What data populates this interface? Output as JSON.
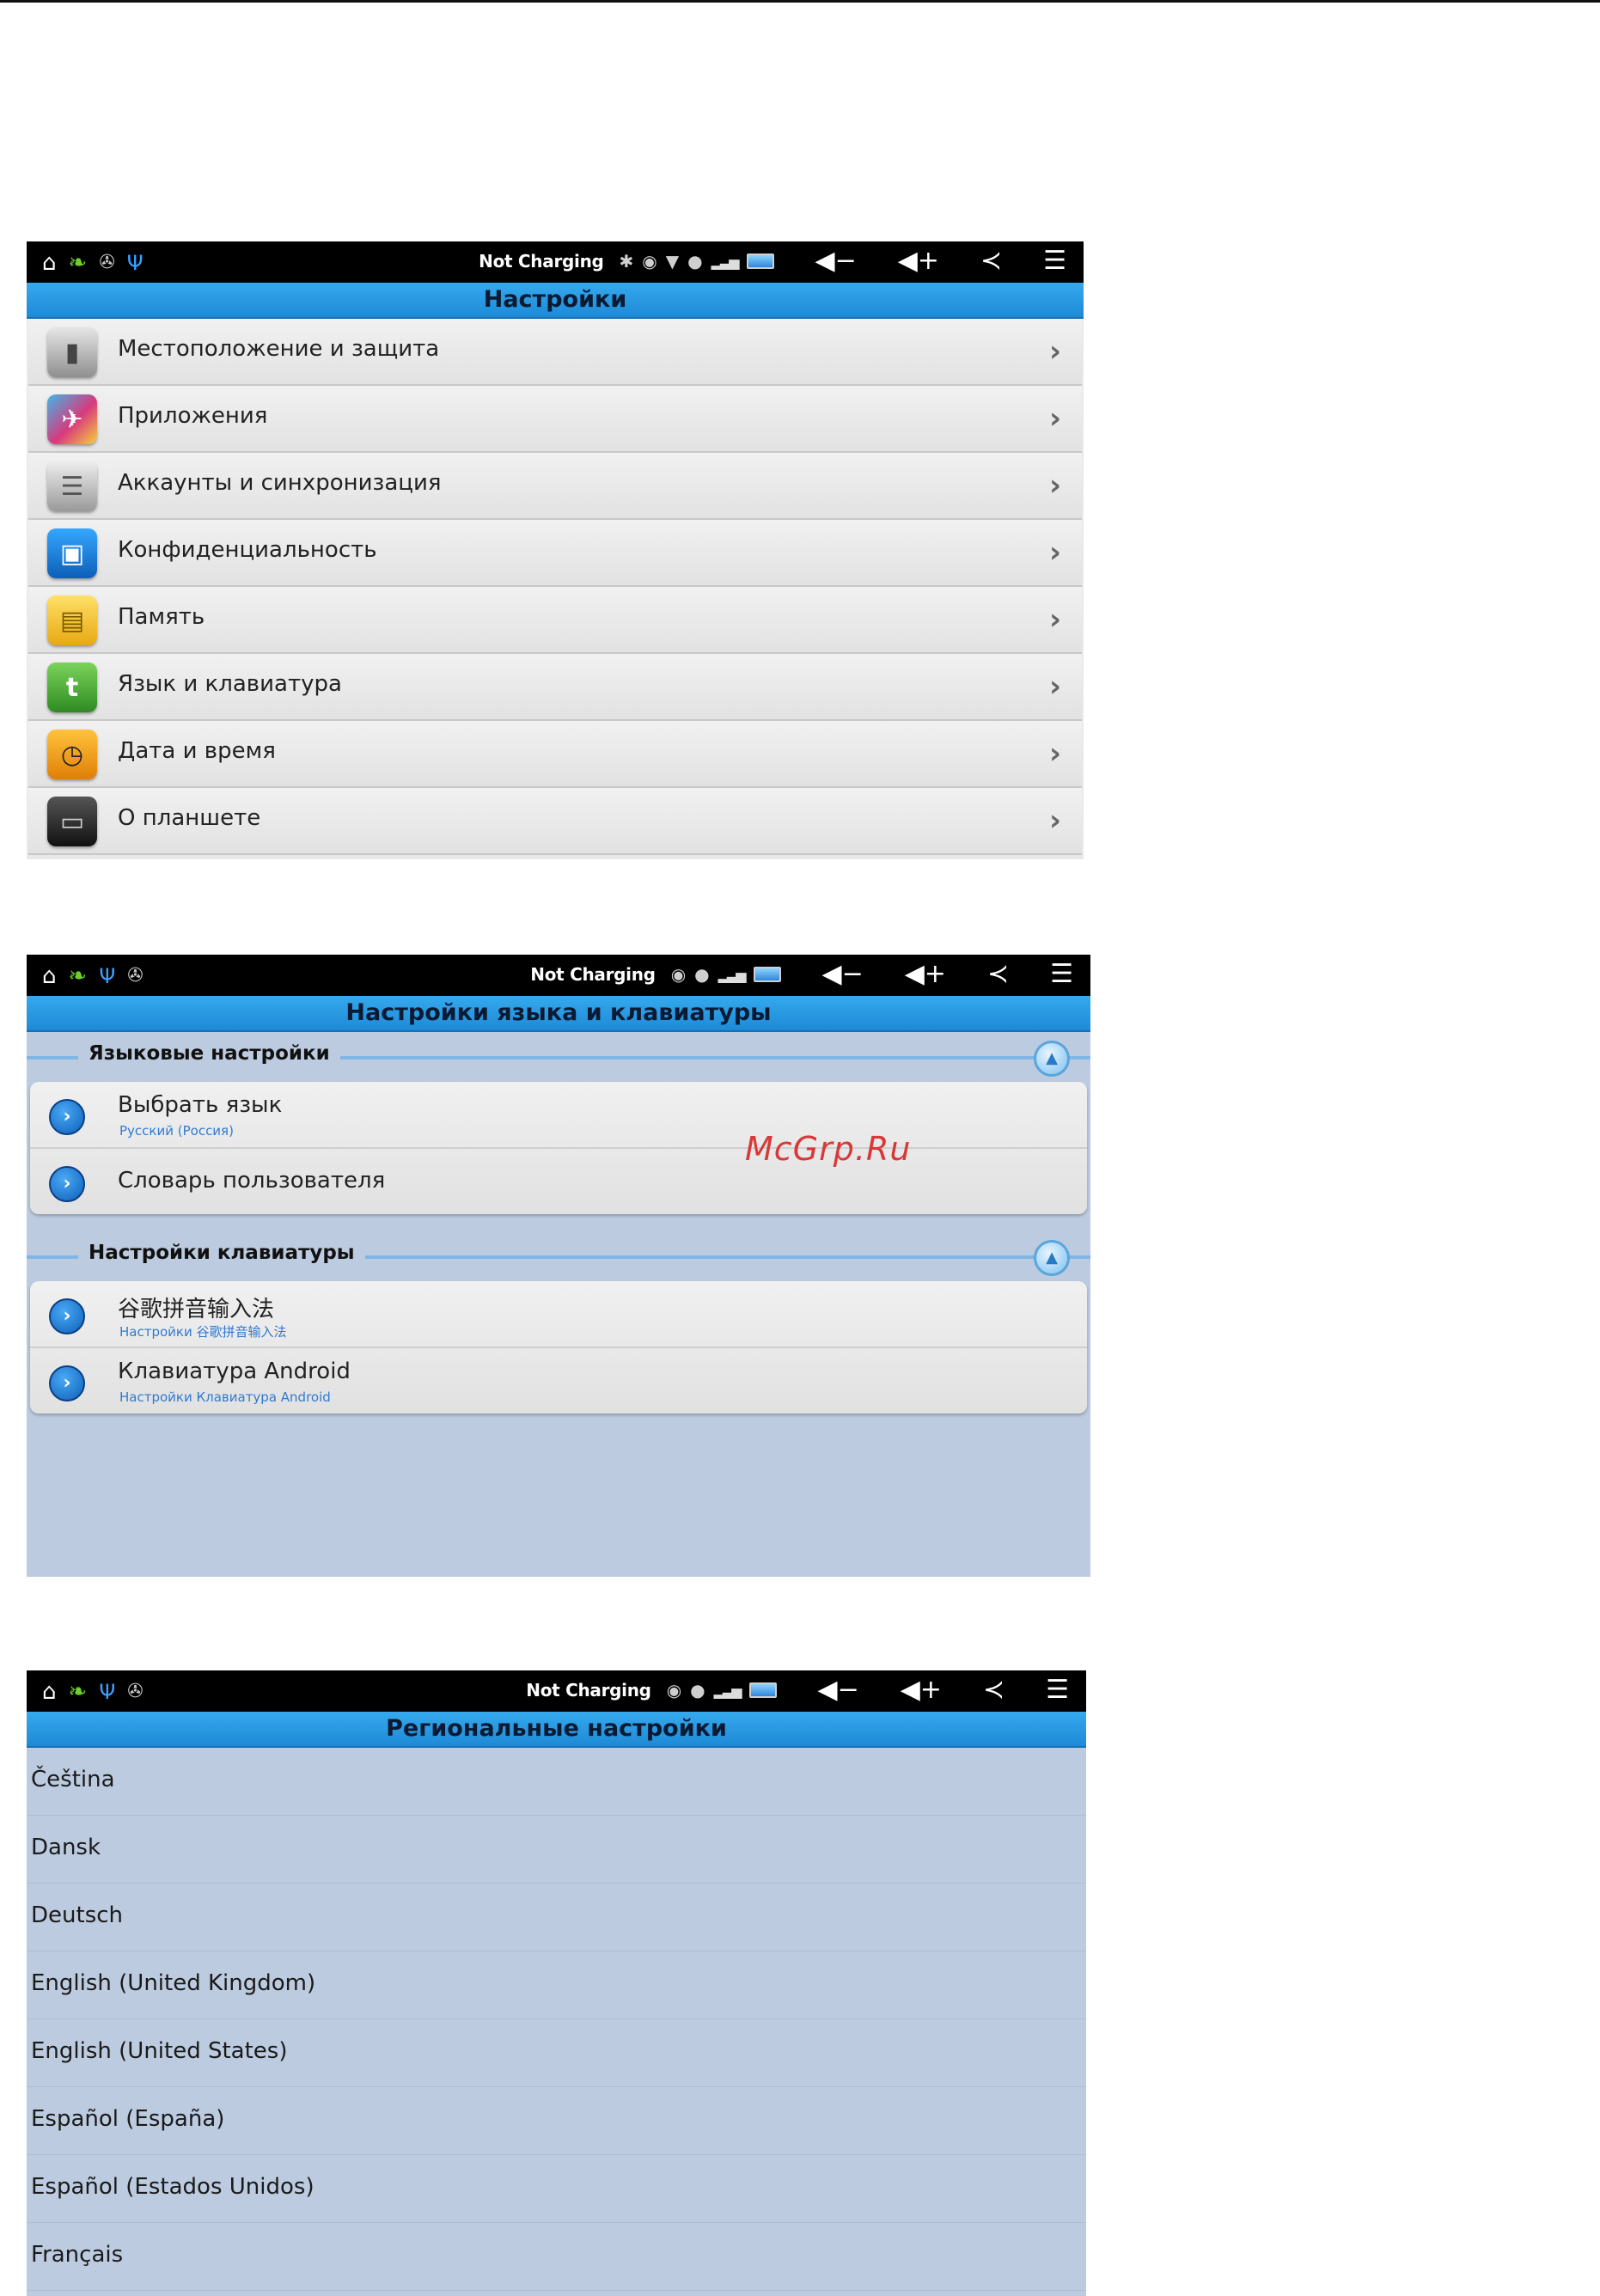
{
  "status_bar": {
    "charging_text": "Not Charging",
    "icons_left": [
      "home-icon",
      "leaf-icon",
      "android-icon",
      "usb-icon"
    ],
    "icons_right": [
      "bluetooth-icon",
      "alarm-icon",
      "wifi-icon",
      "notification-icon",
      "signal-icon",
      "battery-icon"
    ],
    "controls": [
      "volume-down-icon",
      "volume-up-icon",
      "back-icon",
      "menu-icon"
    ]
  },
  "settings": {
    "title": "Настройки",
    "items": [
      {
        "label": "Местоположение и защита",
        "icon": "security-icon",
        "color": "#9b9b9b"
      },
      {
        "label": "Приложения",
        "icon": "apps-icon",
        "color": "#3fb7e6"
      },
      {
        "label": "Аккаунты и синхронизация",
        "icon": "accounts-icon",
        "color": "#a9a9a9"
      },
      {
        "label": "Конфиденциальность",
        "icon": "privacy-icon",
        "color": "#1e7fd8"
      },
      {
        "label": "Память",
        "icon": "memory-icon",
        "color": "#f2c41f"
      },
      {
        "label": "Язык и клавиатура",
        "icon": "language-icon",
        "color": "#47a633"
      },
      {
        "label": "Дата и время",
        "icon": "clock-icon",
        "color": "#f0a11b"
      },
      {
        "label": "О планшете",
        "icon": "tablet-icon",
        "color": "#2b2b2b"
      }
    ]
  },
  "language_keyboard": {
    "title": "Настройки языка и клавиатуры",
    "section_language": "Языковые настройки",
    "select_language": "Выбрать язык",
    "select_language_sub": "Русский (Россия)",
    "user_dictionary": "Словарь пользователя",
    "section_keyboard": "Настройки клавиатуры",
    "ime_google": "谷歌拼音输入法",
    "ime_google_sub": "Настройки 谷歌拼音输入法",
    "ime_android": "Клавиатура Android",
    "ime_android_sub": "Настройки Клавиатура Android",
    "watermark": "McGrp.Ru"
  },
  "regional": {
    "title": "Региональные настройки",
    "locales": [
      "Čeština",
      "Dansk",
      "Deutsch",
      "English (United Kingdom)",
      "English (United States)",
      "Español (España)",
      "Español (Estados Unidos)",
      "Français"
    ]
  }
}
